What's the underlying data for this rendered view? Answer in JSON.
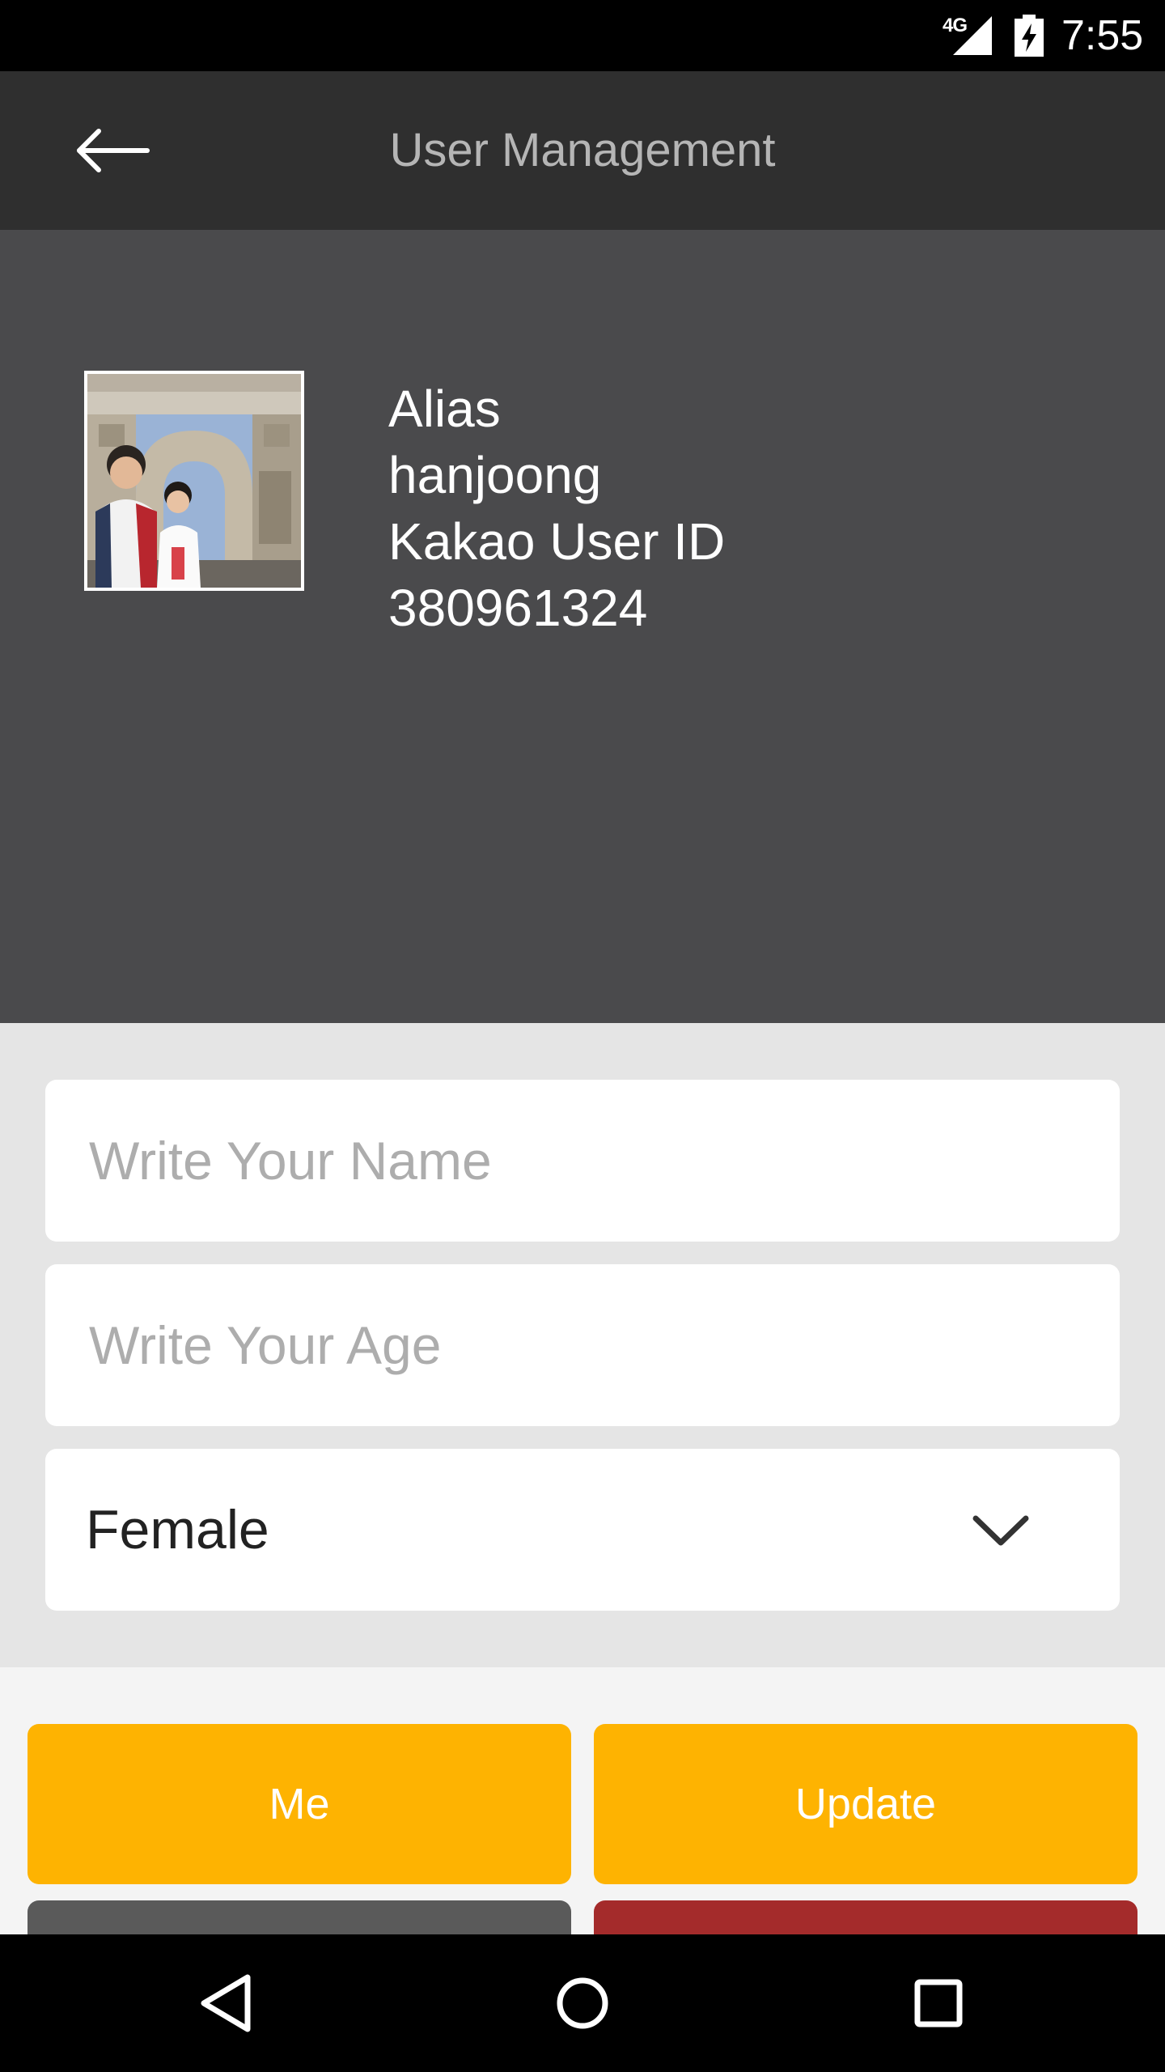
{
  "status_bar": {
    "network_label": "4G",
    "time": "7:55",
    "icons": [
      "signal-icon",
      "battery-charging-icon"
    ]
  },
  "app_bar": {
    "back_icon": "arrow-left-icon",
    "title": "User Management"
  },
  "profile": {
    "avatar_icon": "profile-photo",
    "alias_label": "Alias",
    "alias_value": "hanjoong",
    "id_label": "Kakao User ID",
    "id_value": "380961324"
  },
  "form": {
    "name_placeholder": "Write Your Name",
    "name_value": "",
    "age_placeholder": "Write Your Age",
    "age_value": "",
    "gender_selected": "Female",
    "gender_icon": "chevron-down-icon"
  },
  "buttons": {
    "me_label": "Me",
    "update_label": "Update"
  },
  "nav_bar": {
    "icons": [
      "nav-back-icon",
      "nav-home-icon",
      "nav-recents-icon"
    ]
  },
  "colors": {
    "accent": "#feb301",
    "app_bar_bg": "#2f2f2f",
    "profile_bg": "#4a4a4c",
    "form_bg": "#e5e5e5",
    "danger": "#a42b2b",
    "neutral_button": "#5a5a5a"
  }
}
